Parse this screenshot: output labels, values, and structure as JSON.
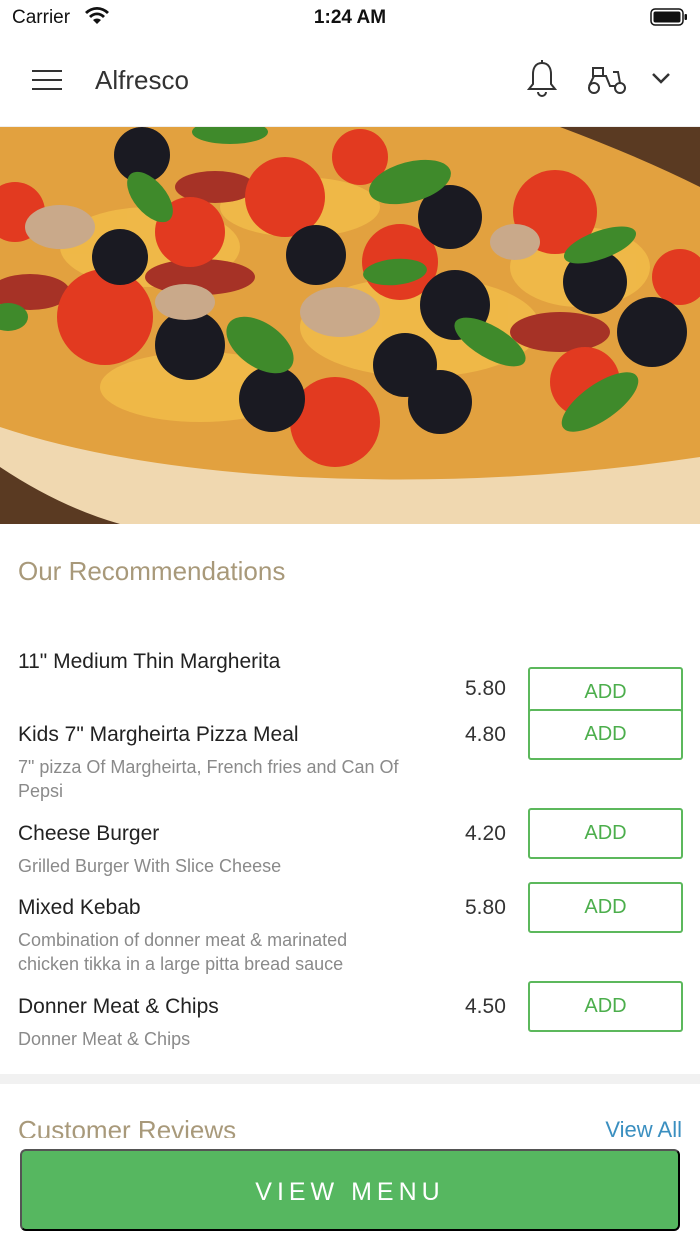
{
  "status_bar": {
    "carrier": "Carrier",
    "time": "1:24 AM"
  },
  "header": {
    "title": "Alfresco"
  },
  "recommendations": {
    "title": "Our Recommendations",
    "items": [
      {
        "name": "11\" Medium Thin Margherita",
        "description": "",
        "price": "5.80",
        "button": "ADD"
      },
      {
        "name": "Kids 7\" Margheirta Pizza Meal",
        "description": "7\" pizza Of Margheirta, French fries and Can Of Pepsi",
        "price": "4.80",
        "button": "ADD"
      },
      {
        "name": "Cheese Burger",
        "description": "Grilled Burger With Slice Cheese",
        "price": "4.20",
        "button": "ADD"
      },
      {
        "name": "Mixed Kebab",
        "description": "Combination of donner meat & marinated chicken tikka in a large pitta bread sauce",
        "price": "5.80",
        "button": "ADD"
      },
      {
        "name": "Donner Meat & Chips",
        "description": "Donner Meat & Chips",
        "price": "4.50",
        "button": "ADD"
      }
    ]
  },
  "reviews": {
    "title": "Customer Reviews",
    "view_all": "View All"
  },
  "footer": {
    "view_menu": "VIEW MENU"
  },
  "colors": {
    "accent_green": "#56b760",
    "section_title": "#a8997a",
    "link_blue": "#3a8fc0"
  },
  "icons": [
    "menu-icon",
    "bell-icon",
    "scooter-icon",
    "chevron-down-icon",
    "wifi-icon",
    "battery-icon"
  ]
}
